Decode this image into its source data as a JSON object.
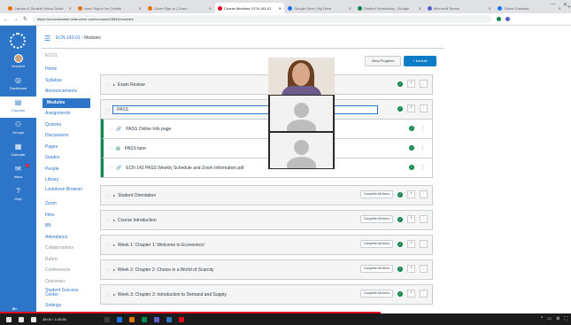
{
  "browser": {
    "tabs": [
      {
        "label": "Canvas & Student Setup Guide",
        "color": "#e37400"
      },
      {
        "label": "Lean Sign-in for Credits",
        "color": "#e37400"
      },
      {
        "label": "Zoom Sign-In | Zoom",
        "color": "#e37400"
      },
      {
        "label": "Course Modules: ECN 143-01",
        "color": "#e0061f",
        "active": true
      },
      {
        "label": "Google Drive | My Drive",
        "color": "#1a73e8"
      },
      {
        "label": "Student Scheduling - Google",
        "color": "#0b874b"
      },
      {
        "label": "Microsoft Teams",
        "color": "#5b5fc7"
      },
      {
        "label": "Online Calendar",
        "color": "#1a73e8"
      }
    ],
    "url": "https://sunshinestate.instructure.com/courses/28843/modules",
    "win_min": "—",
    "win_close": "✕"
  },
  "global_nav": {
    "items": [
      {
        "label": "Account",
        "icon": "user-avatar"
      },
      {
        "label": "Dashboard",
        "icon": "dashboard-icon",
        "glyph": "◎"
      },
      {
        "label": "Courses",
        "icon": "book-icon",
        "glyph": "▤",
        "active": true
      },
      {
        "label": "Groups",
        "icon": "groups-icon",
        "glyph": "⚇"
      },
      {
        "label": "Calendar",
        "icon": "calendar-icon",
        "glyph": "▦"
      },
      {
        "label": "Inbox",
        "icon": "inbox-icon",
        "glyph": "✉",
        "badge": "3"
      },
      {
        "label": "Help",
        "icon": "help-icon",
        "glyph": "?"
      }
    ],
    "collapse": "⇤"
  },
  "header": {
    "menu_glyph": "☰",
    "course": "ECN 143-01",
    "separator": "›",
    "page": "Modules"
  },
  "course_nav": [
    {
      "label": "Home"
    },
    {
      "label": "Syllabus"
    },
    {
      "label": "Announcements"
    },
    {
      "label": "Modules",
      "active": true
    },
    {
      "label": "Assignments"
    },
    {
      "label": "Quizzes"
    },
    {
      "label": "Discussions"
    },
    {
      "label": "Pages"
    },
    {
      "label": "Grades"
    },
    {
      "label": "People"
    },
    {
      "label": "Library"
    },
    {
      "label": "Lockdown Browser",
      "two": true
    },
    {
      "label": "Zoom"
    },
    {
      "label": "Files"
    },
    {
      "label": "BB"
    },
    {
      "label": "Attendance"
    },
    {
      "label": "Collaborations",
      "disabled": true
    },
    {
      "label": "Rubric",
      "disabled": true
    },
    {
      "label": "Conferences",
      "disabled": true
    },
    {
      "label": "Outcomes",
      "disabled": true
    },
    {
      "label": "Student Success Center",
      "two": true
    },
    {
      "label": "Settings"
    }
  ],
  "course_nav_top_label": "ECO1",
  "buttons": {
    "view_progress": "View Progress",
    "add_module": "+ Module"
  },
  "modules": [
    {
      "title": "Exam Review",
      "requirement": ""
    },
    {
      "title": "PASS",
      "editing": true,
      "requirement": "",
      "items": [
        {
          "title": "PASS Online Info page",
          "icon": "link-icon",
          "glyph": "🔗"
        },
        {
          "title": "PASS tutor",
          "icon": "page-icon",
          "glyph": "▤"
        },
        {
          "title": "ECN 143 PASS Weekly Schedule and Zoom Information.pdf",
          "icon": "link-icon",
          "glyph": "🔗"
        }
      ]
    },
    {
      "title": "Student Orientation",
      "requirement": "Complete All Items"
    },
    {
      "title": "Course Introduction",
      "requirement": "Complete All Items"
    },
    {
      "title": "Week 1: Chapter 1: Welcome to Economics!",
      "requirement": "Complete All Items"
    },
    {
      "title": "Week 2: Chapter 2: Choice in a World of Scarcity",
      "requirement": "Complete All Items"
    },
    {
      "title": "Week 3: Chapter 3: Introduction to Demand and Supply",
      "requirement": "Complete All Items"
    }
  ],
  "module_ui": {
    "drag_glyph": "⋮⋮",
    "caret_glyph": "▸",
    "check_glyph": "✓",
    "plus_glyph": "+",
    "kebab_glyph": "⋮"
  },
  "taskbar": {
    "time": "48:00 / 1:05:58",
    "tray": [
      "^",
      "▭",
      "⚙",
      "⛶"
    ]
  }
}
